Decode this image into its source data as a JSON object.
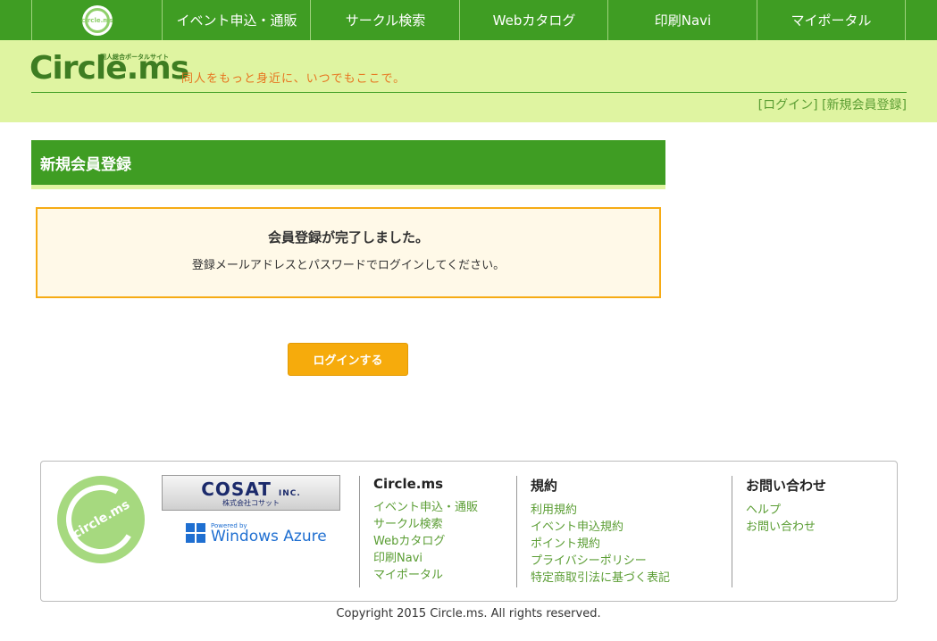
{
  "topnav": {
    "logo_text": "circle.ms",
    "items": [
      "イベント申込・通販",
      "サークル検索",
      "Webカタログ",
      "印刷Navi",
      "マイポータル"
    ]
  },
  "header": {
    "brand": "Circle.ms",
    "brand_sub": "同人総合ポータルサイト",
    "tagline": "同人をもっと身近に、いつでもここで。",
    "login_link": "[ログイン]",
    "register_link": "[新規会員登録]"
  },
  "main": {
    "title": "新規会員登録",
    "notice_heading": "会員登録が完了しました。",
    "notice_text": "登録メールアドレスとパスワードでログインしてください。",
    "login_button": "ログインする"
  },
  "footer": {
    "logo_text": "circle.ms",
    "cosat_name": "COSAT",
    "cosat_inc": "INC.",
    "cosat_jp": "株式会社コサット",
    "azure_powered": "Powered by",
    "azure_name": "Windows Azure",
    "columns": [
      {
        "heading": "Circle.ms",
        "links": [
          "イベント申込・通販",
          "サークル検索",
          "Webカタログ",
          "印刷Navi",
          "マイポータル"
        ]
      },
      {
        "heading": "規約",
        "links": [
          "利用規約",
          "イベント申込規約",
          "ポイント規約",
          "プライバシーポリシー",
          "特定商取引法に基づく表記"
        ]
      },
      {
        "heading": "お問い合わせ",
        "links": [
          "ヘルプ",
          "お問い合わせ"
        ]
      }
    ],
    "copyright": "Copyright 2015 Circle.ms. All rights reserved."
  },
  "colors": {
    "nav_green": "#3f9d23",
    "header_bg": "#dff4a1",
    "link_green": "#5a9d33",
    "button_orange": "#f6ab0c",
    "notice_border": "#f6ab14",
    "tagline_orange": "#e7741f"
  }
}
